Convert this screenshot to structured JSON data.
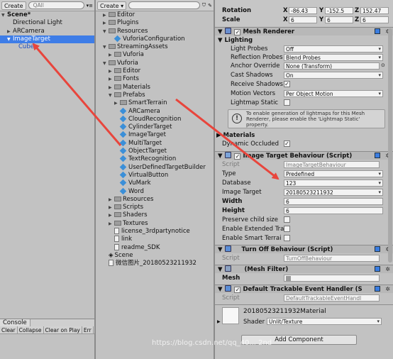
{
  "hierarchy": {
    "create_label": "Create",
    "search_placeholder": "All",
    "items": [
      {
        "label": "Scene*",
        "depth": 0,
        "fold": "▼",
        "bold": true
      },
      {
        "label": "Directional Light",
        "depth": 1,
        "fold": ""
      },
      {
        "label": "ARCamera",
        "depth": 1,
        "fold": "▶"
      },
      {
        "label": "ImageTarget",
        "depth": 1,
        "fold": "▼",
        "selected": true
      },
      {
        "label": "Cube",
        "depth": 2,
        "fold": "",
        "blue": true
      }
    ]
  },
  "console": {
    "tab_label": "Console",
    "buttons": [
      "Clear",
      "Collapse",
      "Clear on Play",
      "Err"
    ]
  },
  "project": {
    "create_label": "Create",
    "items": [
      {
        "label": "Editor",
        "depth": 1,
        "fold": "▶",
        "icon": "folder"
      },
      {
        "label": "Plugins",
        "depth": 1,
        "fold": "▶",
        "icon": "folder"
      },
      {
        "label": "Resources",
        "depth": 1,
        "fold": "▼",
        "icon": "folder"
      },
      {
        "label": "VuforiaConfiguration",
        "depth": 2,
        "fold": "",
        "icon": "prefab"
      },
      {
        "label": "StreamingAssets",
        "depth": 1,
        "fold": "▼",
        "icon": "folder"
      },
      {
        "label": "Vuforia",
        "depth": 2,
        "fold": "▶",
        "icon": "folder"
      },
      {
        "label": "Vuforia",
        "depth": 1,
        "fold": "▼",
        "icon": "folder"
      },
      {
        "label": "Editor",
        "depth": 2,
        "fold": "▶",
        "icon": "folder"
      },
      {
        "label": "Fonts",
        "depth": 2,
        "fold": "▶",
        "icon": "folder"
      },
      {
        "label": "Materials",
        "depth": 2,
        "fold": "▶",
        "icon": "folder"
      },
      {
        "label": "Prefabs",
        "depth": 2,
        "fold": "▼",
        "icon": "folder"
      },
      {
        "label": "SmartTerrain",
        "depth": 3,
        "fold": "▶",
        "icon": "folder"
      },
      {
        "label": "ARCamera",
        "depth": 3,
        "fold": "",
        "icon": "prefab"
      },
      {
        "label": "CloudRecognition",
        "depth": 3,
        "fold": "",
        "icon": "prefab"
      },
      {
        "label": "CylinderTarget",
        "depth": 3,
        "fold": "",
        "icon": "prefab"
      },
      {
        "label": "ImageTarget",
        "depth": 3,
        "fold": "",
        "icon": "prefab"
      },
      {
        "label": "MultiTarget",
        "depth": 3,
        "fold": "",
        "icon": "prefab"
      },
      {
        "label": "ObjectTarget",
        "depth": 3,
        "fold": "",
        "icon": "prefab"
      },
      {
        "label": "TextRecognition",
        "depth": 3,
        "fold": "",
        "icon": "prefab"
      },
      {
        "label": "UserDefinedTargetBuilder",
        "depth": 3,
        "fold": "",
        "icon": "prefab"
      },
      {
        "label": "VirtualButton",
        "depth": 3,
        "fold": "",
        "icon": "prefab"
      },
      {
        "label": "VuMark",
        "depth": 3,
        "fold": "",
        "icon": "prefab"
      },
      {
        "label": "Word",
        "depth": 3,
        "fold": "",
        "icon": "prefab"
      },
      {
        "label": "Resources",
        "depth": 2,
        "fold": "▶",
        "icon": "folder"
      },
      {
        "label": "Scripts",
        "depth": 2,
        "fold": "▶",
        "icon": "folder"
      },
      {
        "label": "Shaders",
        "depth": 2,
        "fold": "▶",
        "icon": "folder"
      },
      {
        "label": "Textures",
        "depth": 2,
        "fold": "▶",
        "icon": "folder"
      },
      {
        "label": "license_3rdpartynotice",
        "depth": 2,
        "fold": "",
        "icon": "file"
      },
      {
        "label": "link",
        "depth": 2,
        "fold": "",
        "icon": "file"
      },
      {
        "label": "readme_SDK",
        "depth": 2,
        "fold": "",
        "icon": "file"
      },
      {
        "label": "Scene",
        "depth": 1,
        "fold": "",
        "icon": "unity"
      },
      {
        "label": "微信图片_20180523211932",
        "depth": 1,
        "fold": "",
        "icon": "file"
      }
    ]
  },
  "inspector": {
    "transform": {
      "rotation_label": "Rotation",
      "scale_label": "Scale",
      "rot": {
        "x": "-86.43",
        "y": "-152.5",
        "z": "152.47"
      },
      "scale": {
        "x": "6",
        "y": "6",
        "z": "6"
      }
    },
    "mesh_renderer": {
      "title": "Mesh Renderer",
      "lighting_label": "Lighting",
      "light_probes_label": "Light Probes",
      "light_probes_value": "Off",
      "reflection_probes_label": "Reflection Probes",
      "reflection_probes_value": "Blend Probes",
      "anchor_override_label": "Anchor Override",
      "anchor_override_value": "None (Transform)",
      "cast_shadows_label": "Cast Shadows",
      "cast_shadows_value": "On",
      "receive_shadows_label": "Receive Shadows",
      "motion_vectors_label": "Motion Vectors",
      "motion_vectors_value": "Per Object Motion",
      "lightmap_static_label": "Lightmap Static",
      "help_text": "To enable generation of lightmaps for this Mesh Renderer, please enable the 'Lightmap Static' property.",
      "materials_label": "Materials",
      "dynamic_occluded_label": "Dynamic Occluded"
    },
    "image_target": {
      "title": "Image Target Behaviour (Script)",
      "script_label": "Script",
      "script_value": "ImageTargetBehaviour",
      "type_label": "Type",
      "type_value": "Predefined",
      "database_label": "Database",
      "database_value": "123",
      "image_target_label": "Image Target",
      "image_target_value": "20180523211932",
      "width_label": "Width",
      "width_value": "6",
      "height_label": "Height",
      "height_value": "6",
      "preserve_label": "Preserve child size",
      "extended_label": "Enable Extended Tra",
      "smart_label": "Enable Smart Terrai"
    },
    "turn_off": {
      "title": "Turn Off Behaviour (Script)",
      "script_label": "Script",
      "script_value": "TurnOffBehaviour"
    },
    "mesh_filter": {
      "title": "(Mesh Filter)",
      "mesh_label": "Mesh"
    },
    "default_handler": {
      "title": "Default Trackable Event Handler (S",
      "script_label": "Script",
      "script_value": "DefaultTrackableEventHandl"
    },
    "material": {
      "name": "20180523211932Material",
      "shader_label": "Shader",
      "shader_value": "Unlit/Texture"
    },
    "add_component_label": "Add Component"
  },
  "watermark": "https://blog.csdn.net/qq_40... 2nd",
  "colors": {
    "selection": "#3e7de7",
    "annotation_arrow": "#e8453c"
  }
}
